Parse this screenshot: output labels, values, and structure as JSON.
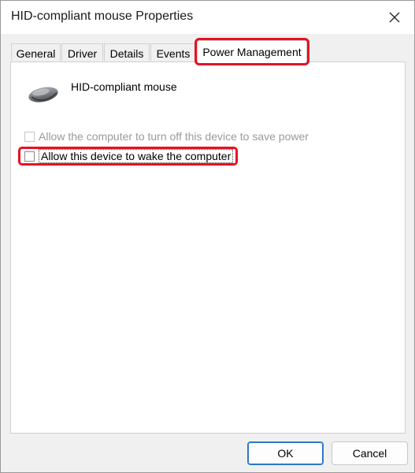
{
  "window": {
    "title": "HID-compliant mouse Properties"
  },
  "tabs": [
    {
      "label": "General"
    },
    {
      "label": "Driver"
    },
    {
      "label": "Details"
    },
    {
      "label": "Events"
    },
    {
      "label": "Power Management",
      "active": true
    }
  ],
  "device": {
    "name": "HID-compliant mouse",
    "icon": "mouse-icon"
  },
  "options": [
    {
      "label": "Allow the computer to turn off this device to save power",
      "checked": false,
      "enabled": false
    },
    {
      "label": "Allow this device to wake the computer",
      "checked": false,
      "enabled": true
    }
  ],
  "buttons": {
    "ok": "OK",
    "cancel": "Cancel"
  },
  "colors": {
    "highlight": "#e81123",
    "accent": "#2b78c9"
  }
}
